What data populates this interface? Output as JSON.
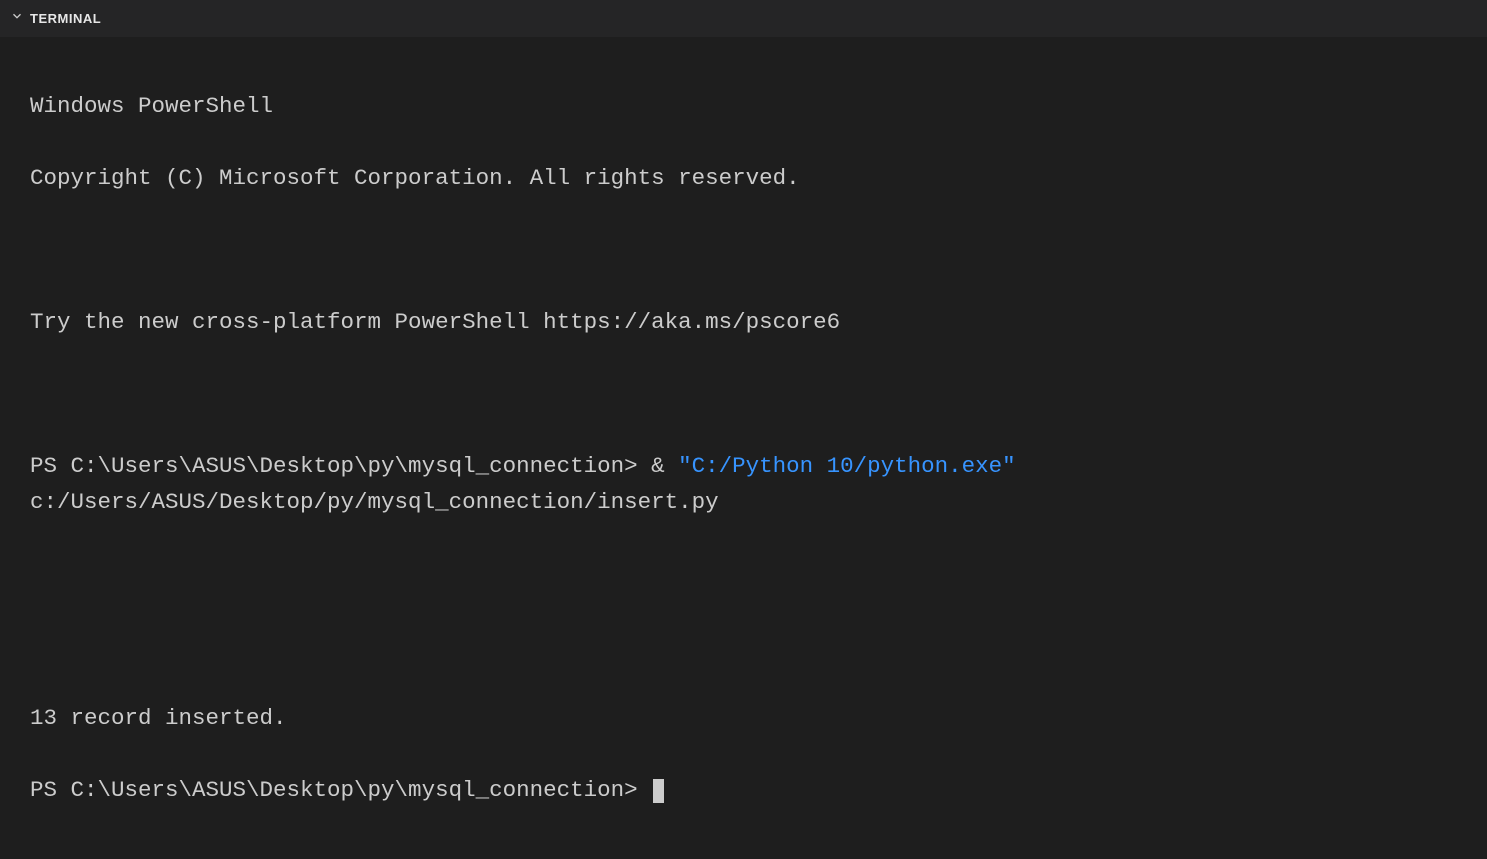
{
  "header": {
    "tab_label": "TERMINAL"
  },
  "terminal": {
    "line1": "Windows PowerShell",
    "line2": "Copyright (C) Microsoft Corporation. All rights reserved.",
    "line3": "Try the new cross-platform PowerShell https://aka.ms/pscore6",
    "prompt1_prefix": "PS C:\\Users\\ASUS\\Desktop\\py\\mysql_connection> & ",
    "prompt1_quoted": "\"C:/Python 10/python.exe\"",
    "prompt1_suffix": " c:/Users/ASUS/Desktop/py/mysql_connection/insert.py",
    "output1": "13 record inserted.",
    "prompt2": "PS C:\\Users\\ASUS\\Desktop\\py\\mysql_connection> "
  }
}
